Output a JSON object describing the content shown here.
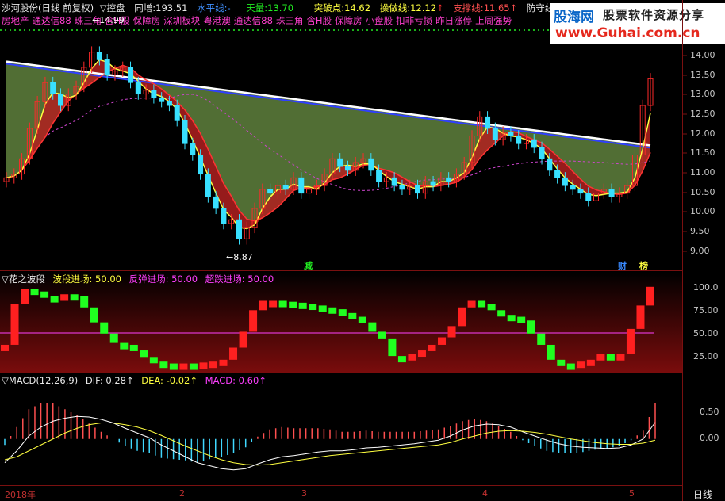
{
  "header": {
    "stock": "沙河股份(日线 前复权)",
    "formula": "▽控盘",
    "tonzeng_label": "同增:",
    "tonzeng": "193.51",
    "water_label": "水平线:",
    "water": "-",
    "tian_label": "天量:",
    "tian": "13.70",
    "tupo_label": "突破点:",
    "tupo": "14.62",
    "caozuo_label": "操做线:",
    "caozuo": "12.12",
    "zhicheng_label": "支撑线:",
    "zhicheng": "11.65",
    "fangshou_label": "防守线"
  },
  "concepts": [
    "房地产",
    "通达信88",
    "珠三角",
    "含H股",
    "保障房",
    "深圳板块",
    "粤港澳",
    "通达信88",
    "珠三角",
    "含H股",
    "保障房",
    "小盘股",
    "扣非亏损",
    "昨日涨停",
    "上周强势"
  ],
  "brand": {
    "logo": "股海网",
    "slogan": "股票软件资源分享",
    "url": "www.Guhai.com.cn"
  },
  "price_axis": [
    "14.00",
    "13.50",
    "13.00",
    "12.50",
    "12.00",
    "11.50",
    "11.00",
    "10.50",
    "10.00",
    "9.50",
    "9.00"
  ],
  "annotations": {
    "high": "14.99",
    "low": "8.87",
    "jian": "减",
    "cai": "财",
    "bang": "榜"
  },
  "wave_panel": {
    "title": "▽花之波段",
    "l1": "波段进场:",
    "v1": "50.00",
    "l2": "反弹进场:",
    "v2": "50.00",
    "l3": "超跌进场:",
    "v3": "50.00",
    "axis": [
      "100.0",
      "75.00",
      "50.00",
      "25.00"
    ]
  },
  "macd_panel": {
    "title": "▽MACD(12,26,9)",
    "dif_label": "DIF:",
    "dif": "0.28↑",
    "dea_label": "DEA:",
    "dea": "-0.02↑",
    "macd_label": "MACD:",
    "macd": "0.60↑",
    "axis": [
      "0.50",
      "0.00"
    ]
  },
  "x_axis": [
    "2018年",
    "2",
    "3",
    "4",
    "5"
  ],
  "period": "日线",
  "chart_data": {
    "type": "candlestick",
    "closes": [
      10.9,
      11.0,
      11.4,
      12.2,
      12.9,
      13.4,
      13.1,
      12.8,
      13.1,
      13.3,
      13.8,
      14.2,
      14.0,
      13.6,
      13.7,
      13.8,
      13.4,
      13.1,
      13.2,
      13.0,
      12.9,
      12.8,
      12.4,
      11.8,
      11.5,
      11.0,
      10.4,
      10.1,
      9.7,
      9.8,
      9.3,
      9.6,
      10.1,
      10.6,
      10.5,
      10.7,
      10.6,
      10.9,
      10.5,
      10.6,
      10.7,
      11.0,
      11.4,
      11.2,
      11.1,
      11.3,
      11.4,
      11.1,
      10.8,
      10.9,
      10.7,
      10.6,
      10.7,
      10.5,
      10.8,
      10.7,
      10.9,
      10.8,
      11.0,
      11.3,
      12.0,
      12.5,
      12.2,
      11.9,
      12.1,
      12.0,
      11.8,
      11.9,
      11.7,
      11.4,
      11.1,
      10.9,
      10.7,
      10.6,
      10.5,
      10.3,
      10.5,
      10.6,
      10.4,
      10.5,
      10.7,
      11.5,
      12.8,
      13.5
    ],
    "bands_ylim": [
      8.6,
      14.4
    ],
    "wave": [
      38,
      82,
      98,
      95,
      90,
      85,
      92,
      90,
      78,
      62,
      50,
      40,
      38,
      32,
      25,
      20,
      18,
      17,
      18,
      17,
      19,
      20,
      22,
      35,
      52,
      75,
      85,
      85,
      84,
      83,
      82,
      80,
      78,
      76,
      72,
      68,
      62,
      52,
      44,
      26,
      22,
      28,
      32,
      38,
      46,
      58,
      78,
      85,
      82,
      75,
      70,
      68,
      64,
      50,
      38,
      22,
      18,
      17,
      20,
      22,
      28,
      26,
      28,
      55,
      80,
      100
    ],
    "wave_ylim": [
      10,
      110
    ],
    "dif": [
      -0.4,
      -0.2,
      0.05,
      0.2,
      0.3,
      0.35,
      0.38,
      0.37,
      0.33,
      0.27,
      0.18,
      0.1,
      0.02,
      -0.1,
      -0.2,
      -0.3,
      -0.4,
      -0.45,
      -0.5,
      -0.52,
      -0.5,
      -0.42,
      -0.35,
      -0.3,
      -0.28,
      -0.25,
      -0.22,
      -0.2,
      -0.2,
      -0.18,
      -0.15,
      -0.14,
      -0.12,
      -0.1,
      -0.08,
      -0.05,
      -0.02,
      0.05,
      0.15,
      0.22,
      0.25,
      0.24,
      0.2,
      0.12,
      0.05,
      -0.02,
      -0.08,
      -0.12,
      -0.14,
      -0.15,
      -0.16,
      -0.15,
      -0.1,
      0.0,
      0.28
    ],
    "dea": [
      -0.35,
      -0.3,
      -0.2,
      -0.1,
      0.0,
      0.1,
      0.18,
      0.24,
      0.27,
      0.27,
      0.24,
      0.2,
      0.14,
      0.06,
      -0.03,
      -0.12,
      -0.2,
      -0.28,
      -0.35,
      -0.4,
      -0.43,
      -0.44,
      -0.43,
      -0.4,
      -0.37,
      -0.34,
      -0.31,
      -0.28,
      -0.26,
      -0.24,
      -0.22,
      -0.2,
      -0.18,
      -0.16,
      -0.14,
      -0.12,
      -0.1,
      -0.06,
      0.0,
      0.05,
      0.1,
      0.13,
      0.14,
      0.13,
      0.11,
      0.08,
      0.04,
      0.0,
      -0.03,
      -0.06,
      -0.08,
      -0.09,
      -0.09,
      -0.07,
      -0.02
    ],
    "macd_ylim": [
      -0.75,
      0.85
    ]
  },
  "colors": {
    "up": "#ff2a2a",
    "down": "#38e0ff",
    "green": "#22ee22",
    "yellow": "#ffff40",
    "blue": "#3040ff",
    "magenta": "#ff3fff",
    "grid_red": "#7a1010"
  }
}
